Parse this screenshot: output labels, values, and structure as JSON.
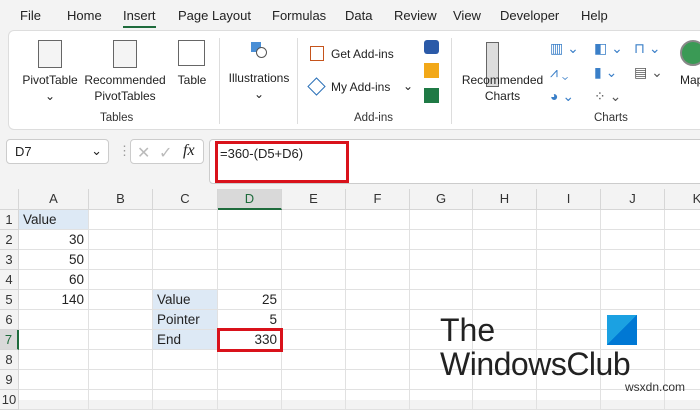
{
  "tabs": [
    "File",
    "Home",
    "Insert",
    "Page Layout",
    "Formulas",
    "Data",
    "Review",
    "View",
    "Developer",
    "Help"
  ],
  "active_tab": "Insert",
  "ribbon": {
    "pivot_table": "PivotTable",
    "recommended_pivot_1": "Recommended",
    "recommended_pivot_2": "PivotTables",
    "table": "Table",
    "tables_group": "Tables",
    "illustrations": "Illustrations",
    "get_addins": "Get Add-ins",
    "my_addins": "My Add-ins",
    "addins_group": "Add-ins",
    "recommended_charts_1": "Recommended",
    "recommended_charts_2": "Charts",
    "charts_group": "Charts",
    "maps": "Map"
  },
  "name_box": "D7",
  "formula": "=360-(D5+D6)",
  "fx": "fx",
  "columns": [
    "A",
    "B",
    "C",
    "D",
    "E",
    "F",
    "G",
    "H",
    "I",
    "J",
    "K"
  ],
  "rows": [
    "1",
    "2",
    "3",
    "4",
    "5",
    "6",
    "7",
    "8",
    "9",
    "10"
  ],
  "selected_cell": "D7",
  "cells": [
    {
      "col": "A",
      "row": 1,
      "value": "Value",
      "align": "left",
      "fill": true
    },
    {
      "col": "A",
      "row": 2,
      "value": "30",
      "align": "right"
    },
    {
      "col": "A",
      "row": 3,
      "value": "50",
      "align": "right"
    },
    {
      "col": "A",
      "row": 4,
      "value": "60",
      "align": "right"
    },
    {
      "col": "A",
      "row": 5,
      "value": "140",
      "align": "right"
    },
    {
      "col": "C",
      "row": 5,
      "value": "Value",
      "align": "left",
      "fill": true
    },
    {
      "col": "C",
      "row": 6,
      "value": "Pointer",
      "align": "left",
      "fill": true
    },
    {
      "col": "C",
      "row": 7,
      "value": "End",
      "align": "left",
      "fill": true
    },
    {
      "col": "D",
      "row": 5,
      "value": "25",
      "align": "right"
    },
    {
      "col": "D",
      "row": 6,
      "value": "5",
      "align": "right"
    },
    {
      "col": "D",
      "row": 7,
      "value": "330",
      "align": "right"
    }
  ],
  "watermark": {
    "line1": "The",
    "line2": "WindowsClub"
  },
  "site": "wsxdn.com"
}
